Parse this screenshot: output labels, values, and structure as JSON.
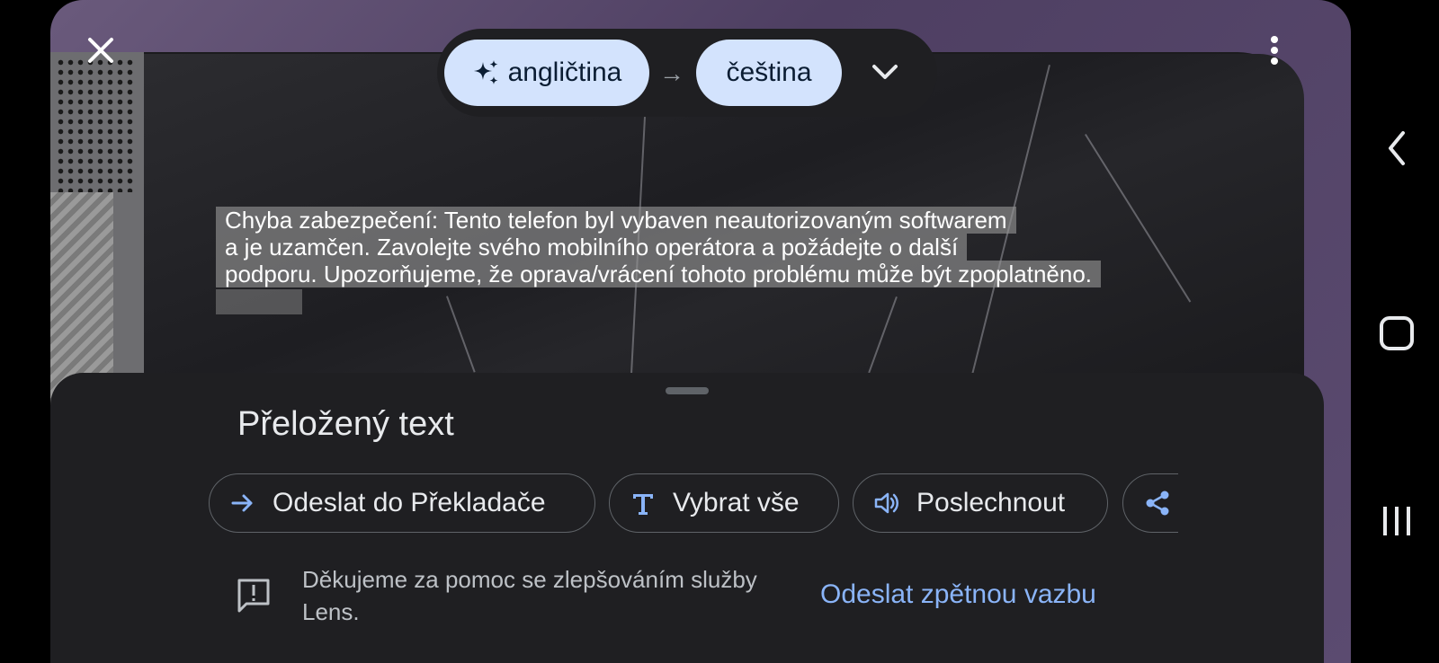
{
  "top_bar": {
    "close_icon": "close-icon",
    "more_icon": "more-vert-icon",
    "source_language": "angličtina",
    "source_icon": "sparkle-icon",
    "arrow": "→",
    "target_language": "čeština",
    "expand_icon": "chevron-down-icon"
  },
  "overlay": {
    "lines": [
      "Chyba zabezpečení: Tento telefon byl vybaven neautorizovaným softwarem",
      "a je uzamčen. Zavolejte svého mobilního operátora a požádejte o další",
      "podporu. Upozorňujeme, že oprava/vrácení tohoto problému může být zpoplatněno."
    ]
  },
  "sheet": {
    "title": "Přeložený text",
    "actions": [
      {
        "label": "Odeslat do Překladače",
        "icon": "arrow-right-icon"
      },
      {
        "label": "Vybrat vše",
        "icon": "text-t-icon"
      },
      {
        "label": "Poslechnout",
        "icon": "speaker-icon"
      },
      {
        "label": "",
        "icon": "share-icon"
      }
    ],
    "feedback_text": "Děkujeme za pomoc se zlepšováním služby Lens.",
    "feedback_link": "Odeslat zpětnou vazbu",
    "feedback_icon": "feedback-icon"
  },
  "colors": {
    "accent": "#8ab4f8",
    "chip_bg": "#d3e3fd",
    "sheet_bg": "#1f1f22"
  }
}
